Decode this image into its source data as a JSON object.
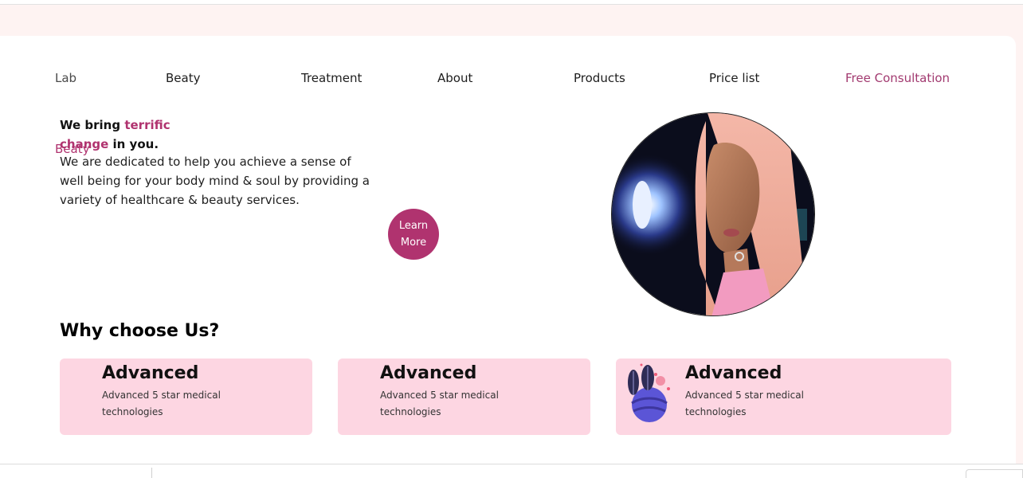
{
  "nav": {
    "brand_part1": "Beaty",
    "brand_part2": "Lab",
    "items": [
      "Beaty",
      "Treatment",
      "About",
      "Products",
      "Price list"
    ],
    "cta": "Free Consultation"
  },
  "hero": {
    "heading_pre": "We bring ",
    "heading_accent": "terrific change",
    "heading_post": " in you.",
    "body": "We are dedicated to help you achieve a sense of well being for your body mind & soul by providing a variety of healthcare & beauty services.",
    "button_label": "Learn More"
  },
  "why": {
    "title": "Why choose Us?",
    "cards": [
      {
        "title": "Advanced",
        "description": "Advanced 5 star medical technologies"
      },
      {
        "title": "Advanced",
        "description": "Advanced 5 star medical technologies"
      },
      {
        "title": "Advanced",
        "description": "Advanced 5 star medical technologies"
      }
    ]
  },
  "colors": {
    "accent": "#b0336f",
    "card_bg": "#fdd6e2",
    "page_bg": "#fef3f2"
  },
  "icons": [
    "portrait-image",
    "leaf-illustration-icon"
  ]
}
